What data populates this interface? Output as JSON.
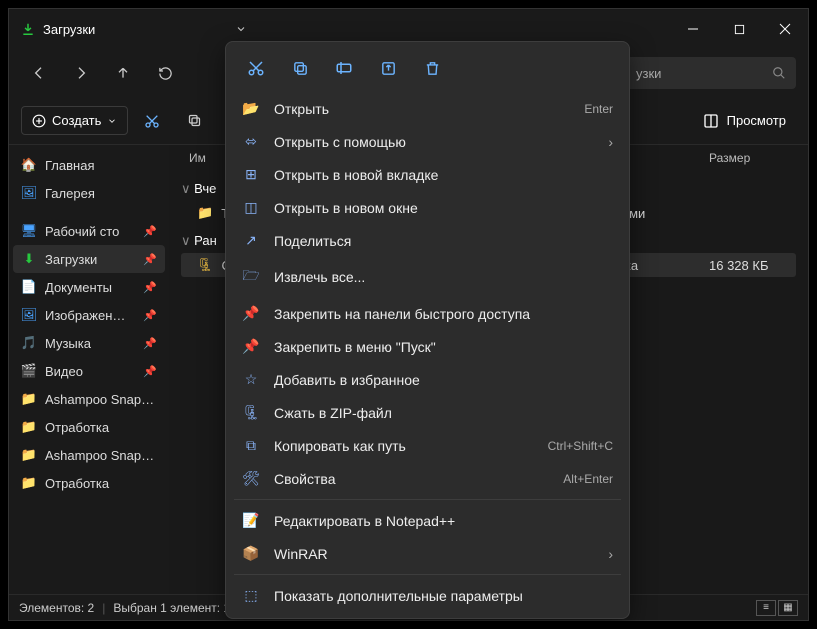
{
  "titlebar": {
    "title": "Загрузки"
  },
  "search": {
    "text": "узки"
  },
  "toolbar": {
    "create": "Создать",
    "view": "Просмотр"
  },
  "sidebar": {
    "home": "Главная",
    "gallery": "Галерея",
    "desktop": "Рабочий сто",
    "downloads": "Загрузки",
    "documents": "Документы",
    "pictures": "Изображен…",
    "music": "Музыка",
    "video": "Видео",
    "ashampoo1": "Ashampoo Snap…",
    "otrabotka1": "Отработка",
    "ashampoo2": "Ashampoo Snap…",
    "otrabotka2": "Отработка"
  },
  "columns": {
    "name": "Им",
    "size": "Размер"
  },
  "groups": {
    "yesterday": "Вче",
    "earlier": "Ран"
  },
  "rows": {
    "te": "Te",
    "c": "C",
    "type1": "с файлами",
    "type2": "ZIP-папка",
    "size2": "16 328 КБ"
  },
  "ctx": {
    "open": "Открыть",
    "open_shortcut": "Enter",
    "open_with": "Открыть с помощью",
    "new_tab": "Открыть в новой вкладке",
    "new_window": "Открыть в новом окне",
    "share": "Поделиться",
    "extract_all": "Извлечь все...",
    "pin_quick": "Закрепить на панели быстрого доступа",
    "pin_start": "Закрепить в меню \"Пуск\"",
    "favorite": "Добавить в избранное",
    "compress": "Сжать в ZIP-файл",
    "copy_path": "Копировать как путь",
    "copy_path_shortcut": "Ctrl+Shift+C",
    "properties": "Свойства",
    "properties_shortcut": "Alt+Enter",
    "notepad": "Редактировать в Notepad++",
    "winrar": "WinRAR",
    "more": "Показать дополнительные параметры"
  },
  "status": {
    "count": "Элементов: 2",
    "selected": "Выбран 1 элемент: 15,9 МБ"
  }
}
